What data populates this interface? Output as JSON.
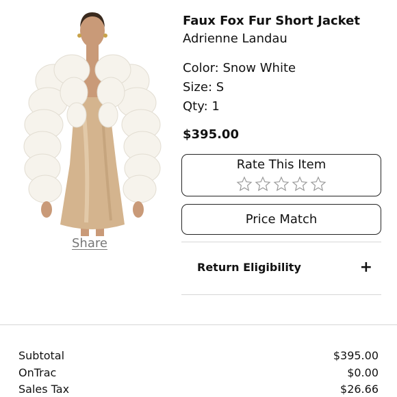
{
  "product": {
    "title": "Faux Fox Fur Short Jacket",
    "brand": "Adrienne Landau",
    "color_line": "Color: Snow White",
    "size_line": "Size: S",
    "qty_line": "Qty: 1",
    "price": "$395.00"
  },
  "share_label": "Share",
  "rating": {
    "label": "Rate This Item",
    "stars_total": 5,
    "stars_filled": 0
  },
  "price_match_label": "Price Match",
  "return_eligibility": {
    "label": "Return Eligibility",
    "icon": "plus-icon"
  },
  "summary": [
    {
      "label": "Subtotal",
      "value": "$395.00"
    },
    {
      "label": "OnTrac",
      "value": "$0.00"
    },
    {
      "label": "Sales Tax",
      "value": "$26.66"
    }
  ],
  "colors": {
    "fur": "#f6f3ec",
    "dress": "#d4b48e",
    "skin": "#c99a78"
  }
}
